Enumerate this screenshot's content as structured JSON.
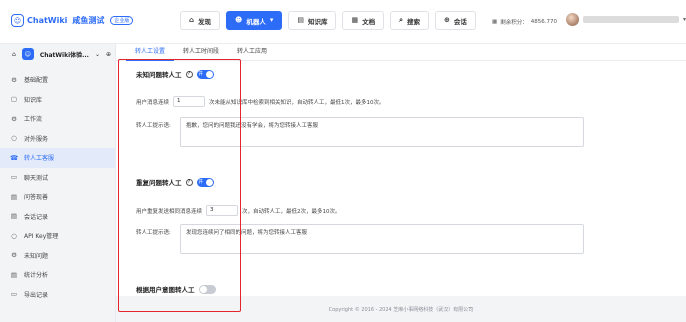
{
  "header": {
    "logo_text": "ChatWiki",
    "logo_sub": "咸鱼测试",
    "version_badge": "企业版",
    "nav": [
      {
        "label": "发现",
        "icon": "⌂",
        "active": false
      },
      {
        "label": "机器人",
        "icon": "☻",
        "active": true
      },
      {
        "label": "知识库",
        "icon": "▤",
        "active": false
      },
      {
        "label": "文档",
        "icon": "▦",
        "active": false
      },
      {
        "label": "搜索",
        "icon": "⌕",
        "active": false
      },
      {
        "label": "会话",
        "icon": "⊕",
        "active": false
      }
    ],
    "credits_label": "剩余积分：",
    "credits_value": "4856.770"
  },
  "sidebar": {
    "robot_name": "ChatWiki体验...",
    "items": [
      {
        "label": "基础配置",
        "icon": "⚙",
        "active": false
      },
      {
        "label": "知识库",
        "icon": "▢",
        "active": false
      },
      {
        "label": "工作流",
        "icon": "⚙",
        "active": false
      },
      {
        "label": "对外服务",
        "icon": "○",
        "active": false
      },
      {
        "label": "转人工客服",
        "icon": "☎",
        "active": true
      },
      {
        "label": "聊天测试",
        "icon": "▭",
        "active": false
      },
      {
        "label": "问答现善",
        "icon": "▤",
        "active": false
      },
      {
        "label": "会话记录",
        "icon": "▤",
        "active": false
      },
      {
        "label": "API Key管理",
        "icon": "○",
        "active": false
      },
      {
        "label": "未知问题",
        "icon": "⚙",
        "active": false
      },
      {
        "label": "统计分析",
        "icon": "▤",
        "active": false
      },
      {
        "label": "导出记录",
        "icon": "▭",
        "active": false
      }
    ]
  },
  "tabs": [
    {
      "label": "转人工设置",
      "active": true
    },
    {
      "label": "转人工时间段",
      "active": false
    },
    {
      "label": "转人工应用",
      "active": false
    }
  ],
  "section1": {
    "title": "未知问题转人工",
    "toggle_text": "开",
    "row_prefix": "用户消息连续",
    "row_value": "1",
    "row_suffix": "次未能从知识库中检索到相关知识，自动转人工，最低1次，最多10次。",
    "prompt_label": "转人工提示语:",
    "prompt_text": "抱歉，您问的问题我还没有学会，将为您转接人工客服"
  },
  "section2": {
    "title": "重复问题转人工",
    "toggle_text": "开",
    "row_prefix": "用户重复发送相同消息连续",
    "row_value": "3",
    "row_suffix": "次，自动转人工，最低2次，最多10次。",
    "prompt_label": "转人工提示语:",
    "prompt_text": "发现您连续问了相同的问题，将为您转接人工客服"
  },
  "section3": {
    "title": "根据用户意图转人工"
  },
  "footer": "Copyright © 2016 - 2024 芝麻小事网络科技（武汉）有限公司"
}
